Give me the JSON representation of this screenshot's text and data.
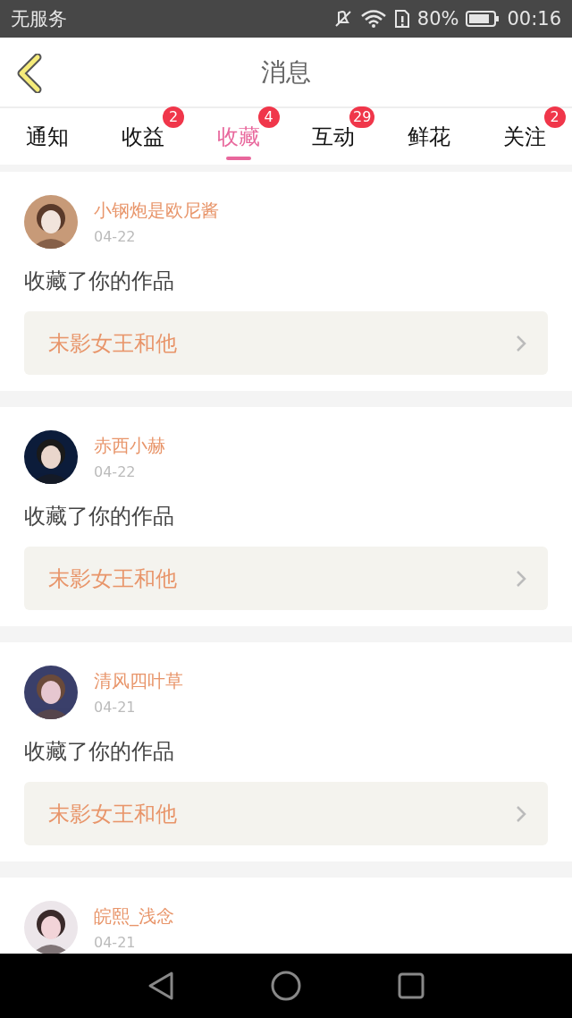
{
  "status_bar": {
    "carrier": "无服务",
    "battery": "80%",
    "time": "00:16"
  },
  "header": {
    "title": "消息"
  },
  "tabs": [
    {
      "label": "通知",
      "selected": false
    },
    {
      "label": "收益",
      "selected": false,
      "badge": "2"
    },
    {
      "label": "收藏",
      "selected": true,
      "badge": "4"
    },
    {
      "label": "互动",
      "selected": false,
      "badge": "29"
    },
    {
      "label": "鲜花",
      "selected": false
    },
    {
      "label": "关注",
      "selected": false,
      "badge": "2"
    }
  ],
  "messages": [
    {
      "user": "小钢炮是欧尼酱",
      "date": "04-22",
      "text": "收藏了你的作品",
      "work": "末影女王和他"
    },
    {
      "user": "赤西小赫",
      "date": "04-22",
      "text": "收藏了你的作品",
      "work": "末影女王和他"
    },
    {
      "user": "清风四叶草",
      "date": "04-21",
      "text": "收藏了你的作品",
      "work": "末影女王和他"
    },
    {
      "user": "皖熙_浅念",
      "date": "04-21"
    }
  ]
}
